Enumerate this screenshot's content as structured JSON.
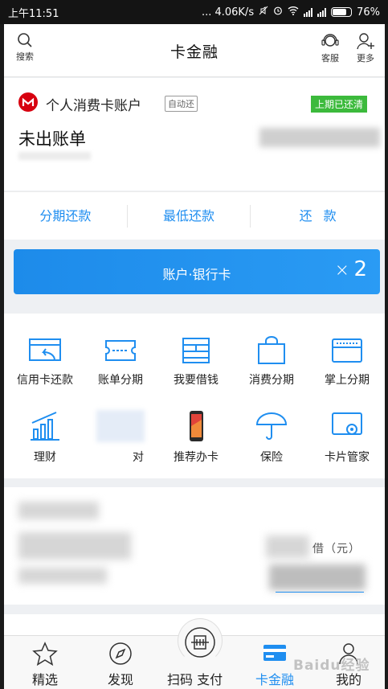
{
  "status_bar": {
    "time": "上午11:51",
    "network_speed": "... 4.06K/s",
    "battery_percent": "76%",
    "battery_level": 0.76
  },
  "header": {
    "title": "卡金融",
    "search_label": "搜索",
    "service_label": "客服",
    "more_label": "更多"
  },
  "account": {
    "name": "个人消费卡账户",
    "auto_repay_tag": "自动还",
    "last_period_badge": "上期已还清",
    "bill_status": "未出账单",
    "brand_color": "#d7000f"
  },
  "actions": [
    {
      "label": "分期还款"
    },
    {
      "label": "最低还款"
    },
    {
      "label": "还款"
    }
  ],
  "banner": {
    "label": "账户·银行卡",
    "count": "2",
    "close_symbol": "×"
  },
  "grid": [
    {
      "icon": "credit-repay-icon",
      "label": "信用卡还款"
    },
    {
      "icon": "bill-installment-icon",
      "label": "账单分期"
    },
    {
      "icon": "borrow-money-icon",
      "label": "我要借钱"
    },
    {
      "icon": "shopping-bag-icon",
      "label": "消费分期"
    },
    {
      "icon": "wallet-installment-icon",
      "label": "掌上分期"
    },
    {
      "icon": "finance-chart-icon",
      "label": "理财"
    },
    {
      "icon": "obscured-icon",
      "label": "对"
    },
    {
      "icon": "phone-icon",
      "label": "推荐办卡"
    },
    {
      "icon": "umbrella-icon",
      "label": "保险"
    },
    {
      "icon": "card-manager-icon",
      "label": "卡片管家"
    }
  ],
  "borrow": {
    "unit_label": "借（元）"
  },
  "tabbar": [
    {
      "icon": "star-icon",
      "label": "精选"
    },
    {
      "icon": "compass-icon",
      "label": "发现"
    },
    {
      "icon": "scan-icon",
      "label": "扫码 支付"
    },
    {
      "icon": "card-icon",
      "label": "卡金融",
      "active": true
    },
    {
      "icon": "person-icon",
      "label": "我的"
    }
  ],
  "watermark": "Baidu经验",
  "colors": {
    "accent": "#1f8ef0",
    "paid_green": "#3cba3c",
    "brand_red": "#d7000f"
  }
}
